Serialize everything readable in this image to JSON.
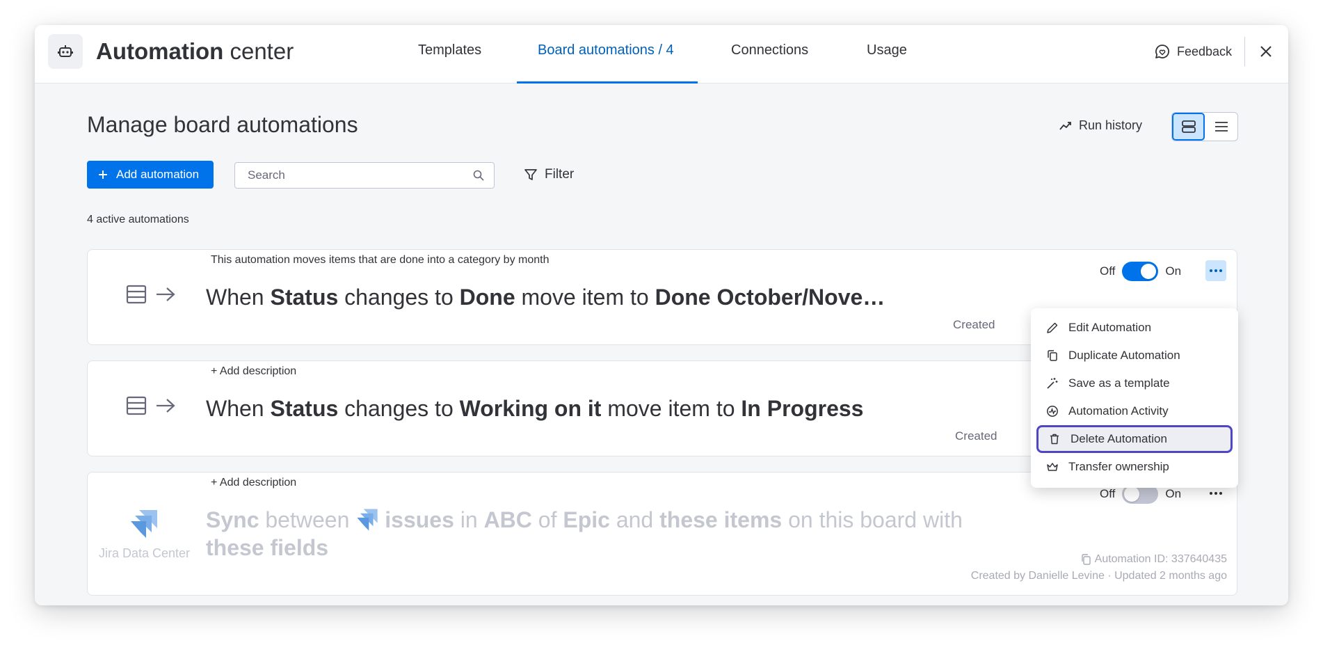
{
  "header": {
    "title_bold": "Automation",
    "title_rest": " center",
    "tabs": [
      {
        "label": "Templates"
      },
      {
        "label": "Board automations / 4"
      },
      {
        "label": "Connections"
      },
      {
        "label": "Usage"
      }
    ],
    "feedback_label": "Feedback"
  },
  "main": {
    "page_title": "Manage board automations",
    "run_history_label": "Run history",
    "add_button_label": "Add automation",
    "search_placeholder": "Search",
    "filter_label": "Filter",
    "active_count": "4 active automations"
  },
  "automations": [
    {
      "description": "This automation moves items that are done into a category by month",
      "recipe": [
        "When ",
        "Status",
        " changes to ",
        "Done",
        " move item to ",
        "Done October/Nove…"
      ],
      "toggle_off": "Off",
      "toggle_on": "On",
      "enabled": true,
      "created": "Created"
    },
    {
      "description": "+ Add description",
      "recipe": [
        "When ",
        "Status",
        " changes to ",
        "Working on it",
        " move item to ",
        "In Progress"
      ],
      "created": "Created"
    },
    {
      "description": "+ Add description",
      "recipe_line1": [
        "Sync",
        " between ",
        "issues",
        " in ",
        "ABC",
        " of ",
        "Epic",
        " and ",
        "these items",
        " on this board with"
      ],
      "recipe_line2": "these fields",
      "source_label": "Jira Data Center",
      "toggle_off": "Off",
      "toggle_on": "On",
      "enabled": false,
      "automation_id": "Automation ID: 337640435",
      "created_by": "Created by Danielle Levine · Updated 2 months ago"
    }
  ],
  "context_menu": {
    "items": [
      {
        "label": "Edit Automation",
        "icon": "pencil-icon"
      },
      {
        "label": "Duplicate Automation",
        "icon": "copy-icon"
      },
      {
        "label": "Save as a template",
        "icon": "magic-wand-icon"
      },
      {
        "label": "Automation Activity",
        "icon": "activity-icon"
      },
      {
        "label": "Delete Automation",
        "icon": "trash-icon"
      },
      {
        "label": "Transfer ownership",
        "icon": "crown-icon"
      }
    ]
  },
  "colors": {
    "accent": "#0073ea",
    "active_tab_text": "#0060b9",
    "highlight_border": "#4f46c4",
    "text": "#323338",
    "muted": "#676879"
  }
}
